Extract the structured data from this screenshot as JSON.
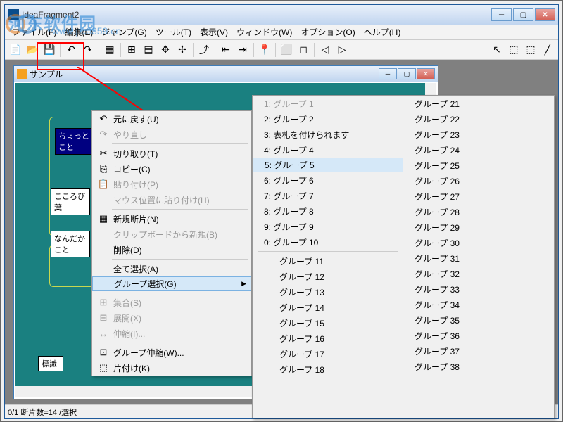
{
  "app": {
    "title": "IdeaFragment2"
  },
  "watermark": {
    "text": "河东软件园",
    "url": "www.pc0359.cn"
  },
  "menubar": [
    "ファイル(F)",
    "編集(E)",
    "ジャンプ(G)",
    "ツール(T)",
    "表示(V)",
    "ウィンドウ(W)",
    "オプション(O)",
    "ヘルプ(H)"
  ],
  "child": {
    "title": "サンプル"
  },
  "nodes": {
    "blue1": "ちょっと\nこと",
    "white1": "こころび\n葉",
    "white2": "なんだか\nこと",
    "white3": "標識"
  },
  "ctx": [
    {
      "type": "item",
      "icon": "↶",
      "label": "元に戻す(U)"
    },
    {
      "type": "item",
      "icon": "↷",
      "label": "やり直し",
      "disabled": true
    },
    {
      "type": "sep"
    },
    {
      "type": "item",
      "icon": "✂",
      "label": "切り取り(T)"
    },
    {
      "type": "item",
      "icon": "⎘",
      "label": "コピー(C)"
    },
    {
      "type": "item",
      "icon": "📋",
      "label": "貼り付け(P)",
      "disabled": true
    },
    {
      "type": "item",
      "icon": "",
      "label": "マウス位置に貼り付け(H)",
      "disabled": true
    },
    {
      "type": "sep"
    },
    {
      "type": "item",
      "icon": "▦",
      "label": "新規断片(N)"
    },
    {
      "type": "item",
      "icon": "",
      "label": "クリップボードから新規(B)",
      "disabled": true
    },
    {
      "type": "item",
      "icon": "",
      "label": "削除(D)"
    },
    {
      "type": "sep"
    },
    {
      "type": "item",
      "icon": "",
      "label": "全て選択(A)"
    },
    {
      "type": "item",
      "icon": "",
      "label": "グループ選択(G)",
      "arrow": true,
      "hover": true
    },
    {
      "type": "sep"
    },
    {
      "type": "item",
      "icon": "⊞",
      "label": "集合(S)",
      "disabled": true
    },
    {
      "type": "item",
      "icon": "⊟",
      "label": "展開(X)",
      "disabled": true
    },
    {
      "type": "item",
      "icon": "↔",
      "label": "伸縮(I)...",
      "disabled": true
    },
    {
      "type": "sep"
    },
    {
      "type": "item",
      "icon": "⊡",
      "label": "グループ伸縮(W)..."
    },
    {
      "type": "item",
      "icon": "⬚",
      "label": "片付け(K)"
    }
  ],
  "submenu": {
    "col1": [
      {
        "label": "1: グループ  1",
        "disabled": true
      },
      {
        "label": "2: グループ  2"
      },
      {
        "label": "3: 表札を付けられます"
      },
      {
        "label": "4: グループ  4"
      },
      {
        "label": "5: グループ  5",
        "hover": true
      },
      {
        "label": "6: グループ  6"
      },
      {
        "label": "7: グループ  7"
      },
      {
        "label": "8: グループ  8"
      },
      {
        "label": "9: グループ  9"
      },
      {
        "label": "0: グループ 10"
      },
      {
        "label": "グループ 11",
        "indent": true
      },
      {
        "label": "グループ 12",
        "indent": true
      },
      {
        "label": "グループ 13",
        "indent": true
      },
      {
        "label": "グループ 14",
        "indent": true
      },
      {
        "label": "グループ 15",
        "indent": true
      },
      {
        "label": "グループ 16",
        "indent": true
      },
      {
        "label": "グループ 17",
        "indent": true
      },
      {
        "label": "グループ 18",
        "indent": true
      }
    ],
    "col2": [
      {
        "label": "グループ 21"
      },
      {
        "label": "グループ 22"
      },
      {
        "label": "グループ 23"
      },
      {
        "label": "グループ 24"
      },
      {
        "label": "グループ 25"
      },
      {
        "label": "グループ 26"
      },
      {
        "label": "グループ 27"
      },
      {
        "label": "グループ 28"
      },
      {
        "label": "グループ 29"
      },
      {
        "label": "グループ 30"
      },
      {
        "label": "グループ 31"
      },
      {
        "label": "グループ 32"
      },
      {
        "label": "グループ 33"
      },
      {
        "label": "グループ 34"
      },
      {
        "label": "グループ 35"
      },
      {
        "label": "グループ 36"
      },
      {
        "label": "グループ 37"
      },
      {
        "label": "グループ 38"
      }
    ]
  },
  "statusbar": "0/1   断片数=14  /選択"
}
